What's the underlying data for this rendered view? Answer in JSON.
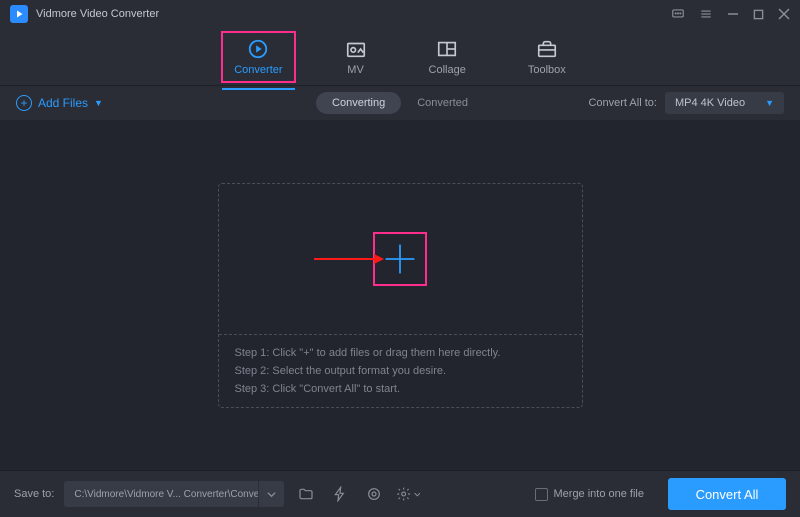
{
  "app": {
    "title": "Vidmore Video Converter"
  },
  "tabs": {
    "converter": "Converter",
    "mv": "MV",
    "collage": "Collage",
    "toolbox": "Toolbox"
  },
  "subbar": {
    "add_files": "Add Files",
    "converting": "Converting",
    "converted": "Converted",
    "convert_all_to": "Convert All to:",
    "format": "MP4 4K Video"
  },
  "dropzone": {
    "step1": "Step 1: Click \"+\" to add files or drag them here directly.",
    "step2": "Step 2: Select the output format you desire.",
    "step3": "Step 3: Click \"Convert All\" to start."
  },
  "footer": {
    "save_to": "Save to:",
    "path": "C:\\Vidmore\\Vidmore V... Converter\\Converted",
    "merge": "Merge into one file",
    "convert_all": "Convert All"
  }
}
